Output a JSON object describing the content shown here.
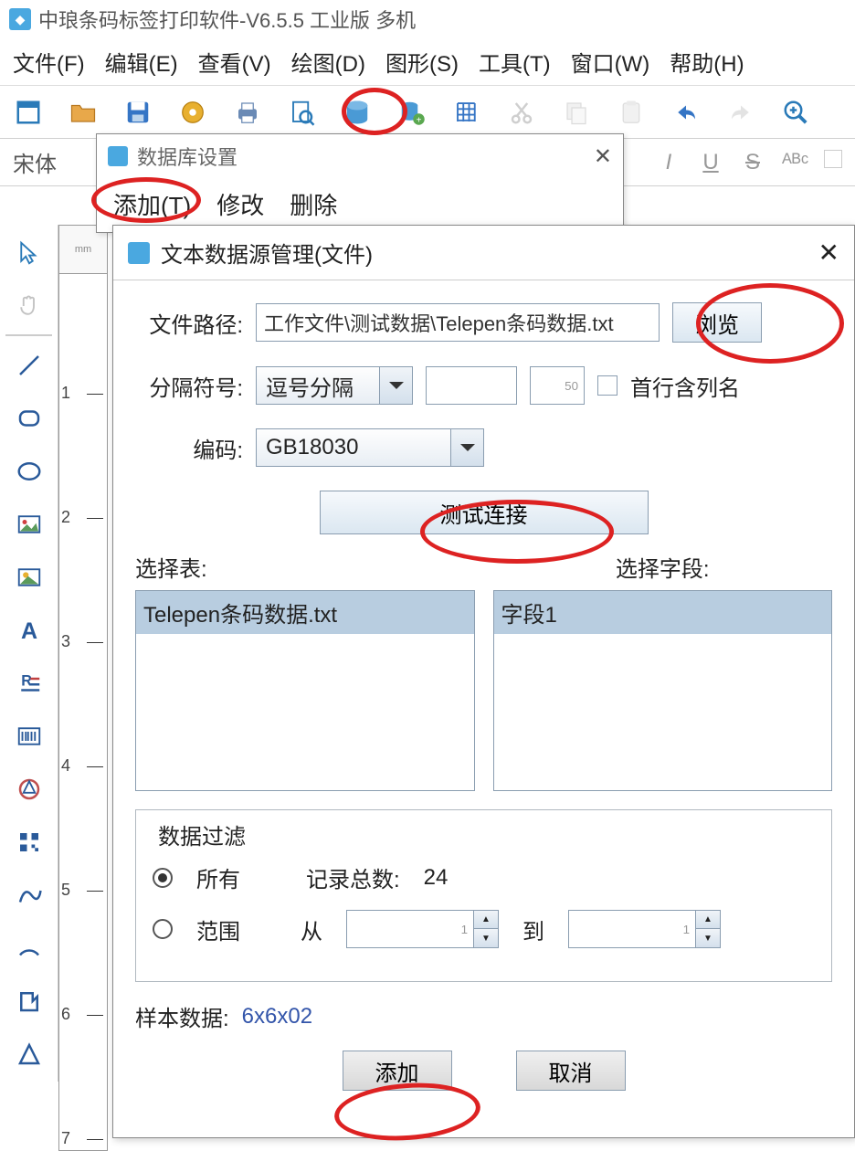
{
  "app": {
    "title": "中琅条码标签打印软件-V6.5.5 工业版 多机"
  },
  "menubar": {
    "file": "文件(F)",
    "edit": "编辑(E)",
    "view": "查看(V)",
    "draw": "绘图(D)",
    "shape": "图形(S)",
    "tool": "工具(T)",
    "window": "窗口(W)",
    "help": "帮助(H)"
  },
  "fontbar": {
    "font": "宋体",
    "italic": "I",
    "underline": "U",
    "strike": "S",
    "abc": "ᴬᴮᶜ"
  },
  "db_dialog": {
    "title": "数据库设置",
    "add": "添加(T)",
    "modify": "修改",
    "delete": "删除"
  },
  "ds_dialog": {
    "title": "文本数据源管理(文件)",
    "path_label": "文件路径:",
    "path_value": "工作文件\\测试数据\\Telepen条码数据.txt",
    "browse": "浏览",
    "delim_label": "分隔符号:",
    "delim_value": "逗号分隔",
    "limit_value": "50",
    "first_row_header": "首行含列名",
    "encoding_label": "编码:",
    "encoding_value": "GB18030",
    "test_connection": "测试连接",
    "select_table": "选择表:",
    "table_item": "Telepen条码数据.txt",
    "select_field": "选择字段:",
    "field_item": "字段1",
    "filter_legend": "数据过滤",
    "radio_all": "所有",
    "record_count_label": "记录总数:",
    "record_count": "24",
    "radio_range": "范围",
    "from_label": "从",
    "from_value": "1",
    "to_label": "到",
    "to_value": "1",
    "sample_label": "样本数据:",
    "sample_value": "6x6x02",
    "ok": "添加",
    "cancel": "取消"
  },
  "ruler": {
    "t1": "1",
    "t2": "2",
    "t3": "3",
    "t4": "4",
    "t5": "5",
    "t6": "6",
    "t7": "7"
  }
}
